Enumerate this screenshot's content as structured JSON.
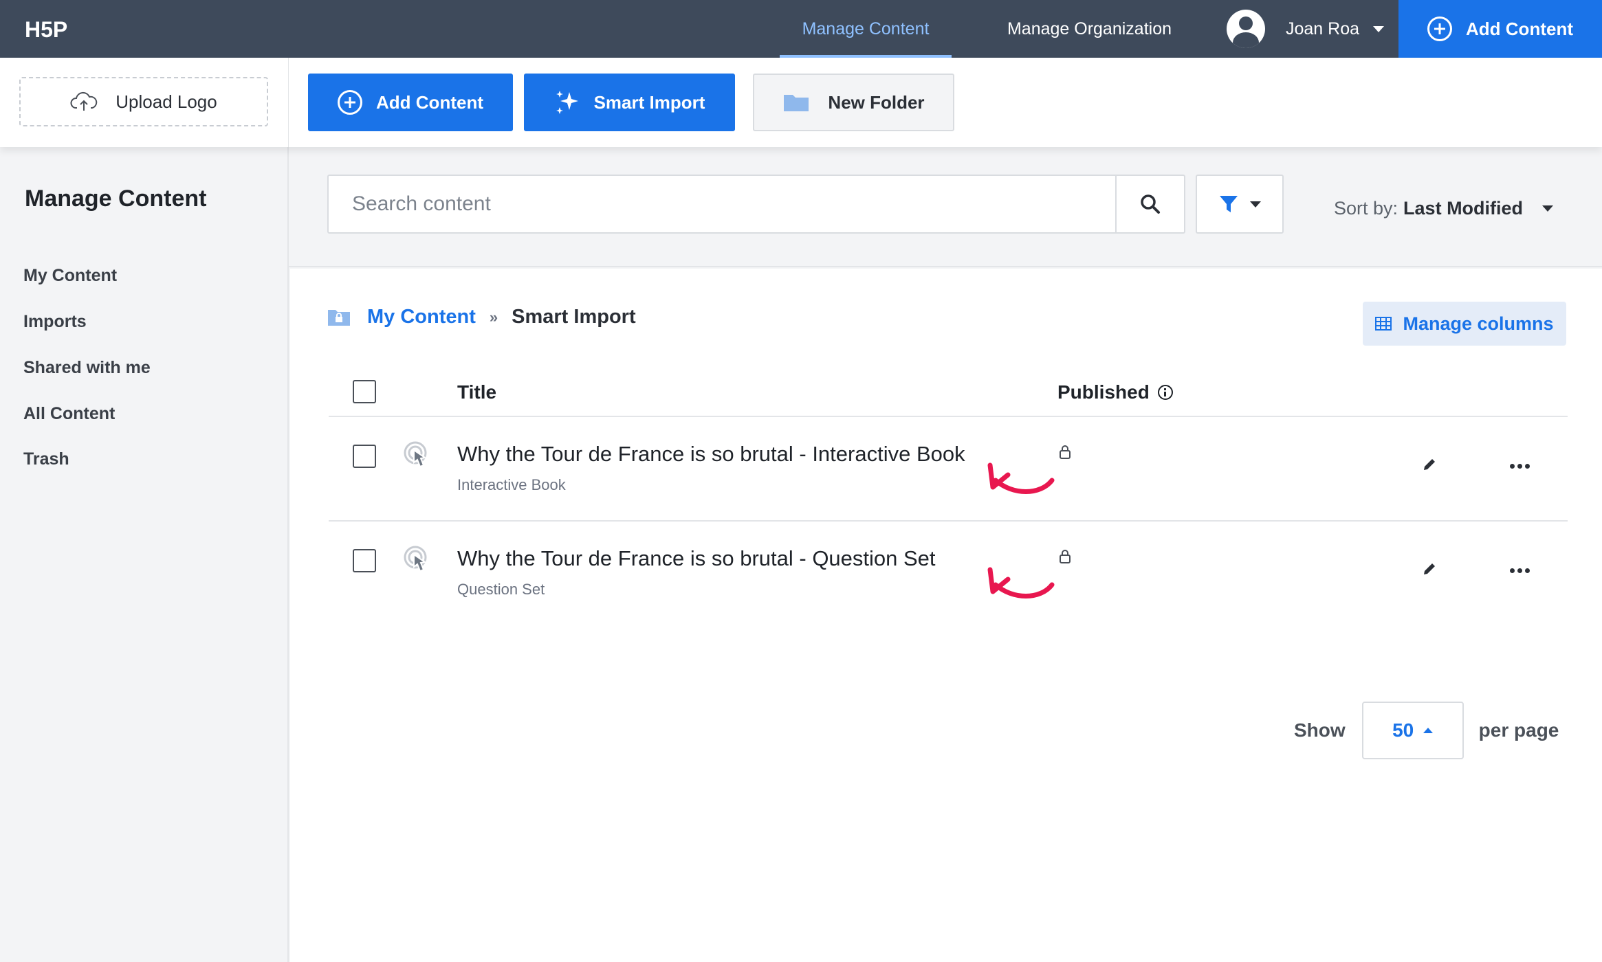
{
  "topbar": {
    "logo_text": "H5P",
    "nav": [
      {
        "label": "Manage Content",
        "active": true
      },
      {
        "label": "Manage Organization",
        "active": false
      }
    ],
    "user_name": "Joan Roa",
    "add_content_label": "Add Content"
  },
  "toolbar": {
    "upload_logo_label": "Upload Logo",
    "add_content_label": "Add Content",
    "smart_import_label": "Smart Import",
    "new_folder_label": "New Folder"
  },
  "sidebar": {
    "title": "Manage Content",
    "items": [
      {
        "label": "My Content"
      },
      {
        "label": "Imports"
      },
      {
        "label": "Shared with me"
      },
      {
        "label": "All Content"
      },
      {
        "label": "Trash"
      }
    ]
  },
  "search": {
    "placeholder": "Search content",
    "value": "",
    "sort_prefix": "Sort by:",
    "sort_value": "Last Modified"
  },
  "breadcrumb": {
    "root": "My Content",
    "separator": "»",
    "current": "Smart Import"
  },
  "manage_columns_label": "Manage columns",
  "table": {
    "columns": {
      "title": "Title",
      "published": "Published"
    },
    "rows": [
      {
        "title": "Why the Tour de France is so brutal - Interactive Book",
        "type": "Interactive Book",
        "published": "locked"
      },
      {
        "title": "Why the Tour de France is so brutal - Question Set",
        "type": "Question Set",
        "published": "locked"
      }
    ]
  },
  "pagination": {
    "show_label": "Show",
    "per_page_value": "50",
    "per_page_label": "per page"
  },
  "colors": {
    "topbar": "#3e4a5b",
    "primary": "#1a73e8",
    "active_nav": "#8fc1ff",
    "annotation_arrow": "#e8174f"
  },
  "icons": [
    "h5p-logo",
    "user-avatar-icon",
    "plus-circle-icon",
    "cloud-upload-icon",
    "sparkles-icon",
    "folder-icon",
    "search-icon",
    "filter-icon",
    "folder-lock-icon",
    "table-columns-icon",
    "info-icon",
    "content-type-icon",
    "lock-icon",
    "pencil-icon",
    "ellipsis-icon",
    "annotation-arrow"
  ]
}
